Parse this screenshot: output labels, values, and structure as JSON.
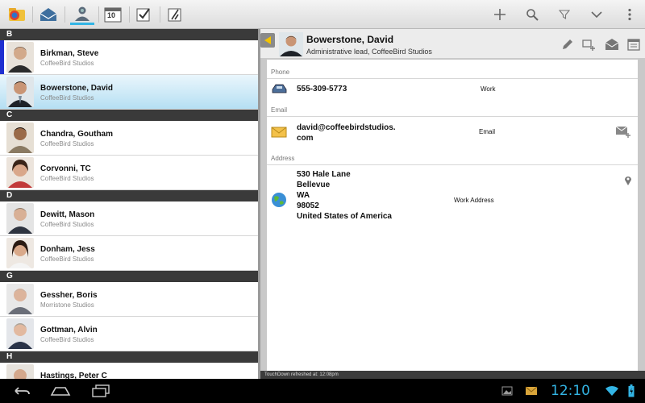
{
  "toolbar": {
    "tabs": [
      {
        "icon": "app-logo-icon"
      },
      {
        "icon": "mail-tray-icon"
      },
      {
        "icon": "contacts-icon",
        "active": true
      },
      {
        "icon": "calendar-icon",
        "text": "10"
      },
      {
        "icon": "tasks-icon"
      },
      {
        "icon": "notes-icon"
      }
    ],
    "actions": [
      "add-icon",
      "search-icon",
      "filter-icon",
      "chevron-down-icon",
      "overflow-menu-icon"
    ]
  },
  "contacts": {
    "sections": [
      {
        "letter": "B",
        "items": [
          {
            "name": "Birkman, Steve",
            "company": "CoffeeBird Studios",
            "marked": true
          },
          {
            "name": "Bowerstone, David",
            "company": "CoffeeBird Studios",
            "selected": true
          }
        ]
      },
      {
        "letter": "C",
        "items": [
          {
            "name": "Chandra, Goutham",
            "company": "CoffeeBird Studios"
          },
          {
            "name": "Corvonni, TC",
            "company": "CoffeeBird Studios"
          }
        ]
      },
      {
        "letter": "D",
        "items": [
          {
            "name": "Dewitt, Mason",
            "company": "CoffeeBird Studios"
          },
          {
            "name": "Donham, Jess",
            "company": "CoffeeBird Studios"
          }
        ]
      },
      {
        "letter": "G",
        "items": [
          {
            "name": "Gessher, Boris",
            "company": "Morristone Studios"
          },
          {
            "name": "Gottman, Alvin",
            "company": "CoffeeBird Studios"
          }
        ]
      },
      {
        "letter": "H",
        "items": [
          {
            "name": "Hastings, Peter C",
            "company": ""
          }
        ]
      }
    ]
  },
  "detail": {
    "name": "Bowerstone, David",
    "subtitle": "Administrative lead, CoffeeBird Studios",
    "phone_label": "Phone",
    "phone": "555-309-5773",
    "phone_type": "Work",
    "email_label": "Email",
    "email_line1": "david@coffeebirdstudios.",
    "email_line2": "com",
    "email_type": "Email",
    "address_label": "Address",
    "address_lines": [
      "530 Hale Lane",
      "Bellevue",
      "WA",
      "98052",
      "United States of America"
    ],
    "address_type": "Work Address"
  },
  "status": "TouchDown refreshed at: 12:08pm",
  "system": {
    "time": "12:10"
  },
  "colors": {
    "accent": "#33b5e5",
    "section": "#3a3a3a",
    "marker": "#1f2fd0"
  }
}
